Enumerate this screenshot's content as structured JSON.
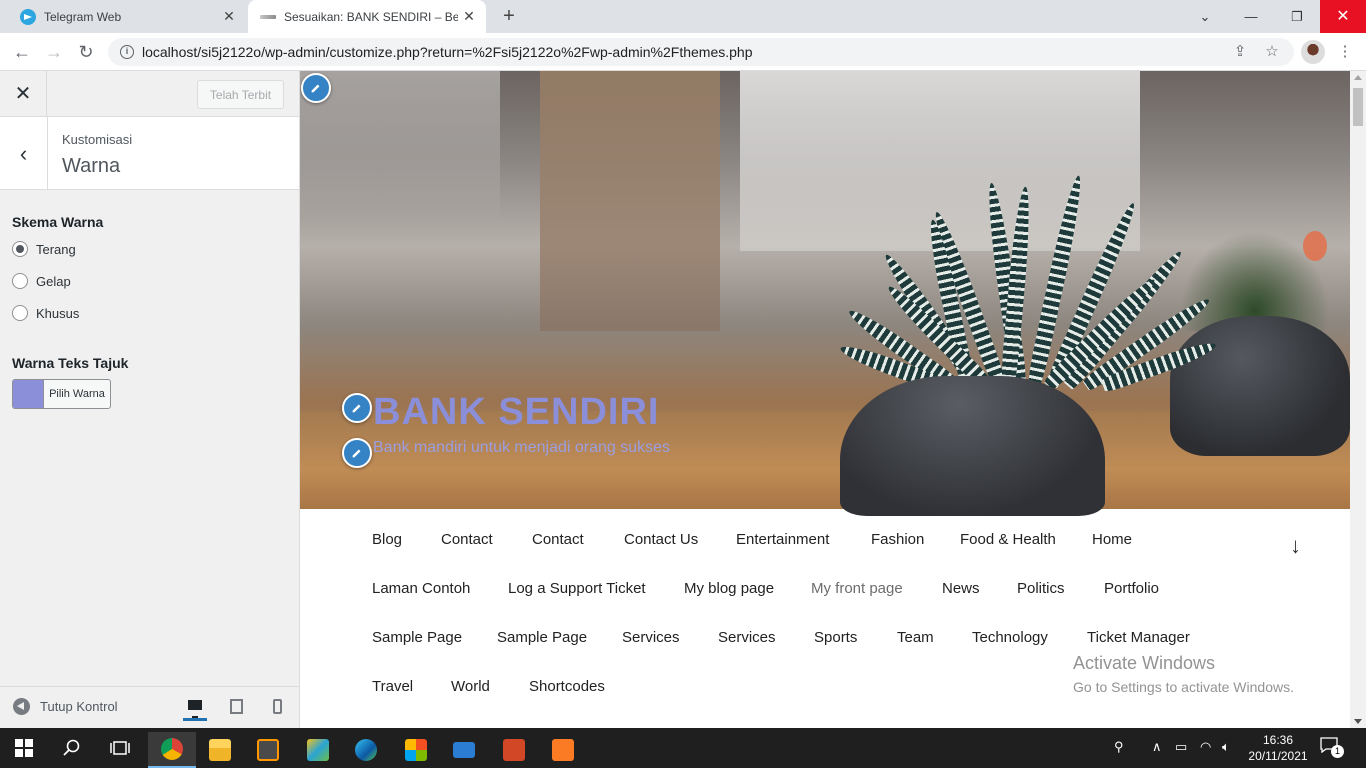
{
  "browser": {
    "tabs": [
      {
        "title": "Telegram Web"
      },
      {
        "title": "Sesuaikan: BANK SENDIRI – Belaj"
      }
    ],
    "url": "localhost/si5j2122o/wp-admin/customize.php?return=%2Fsi5j2122o%2Fwp-admin%2Fthemes.php"
  },
  "sidebar": {
    "publish_label": "Telah Terbit",
    "breadcrumb": "Kustomisasi",
    "section_title": "Warna",
    "color_scheme": {
      "label": "Skema Warna",
      "options": [
        "Terang",
        "Gelap",
        "Khusus"
      ],
      "selected": "Terang"
    },
    "header_text_color": {
      "label": "Warna Teks Tajuk",
      "button_label": "Pilih Warna",
      "value": "#8b8fd9"
    },
    "collapse_label": "Tutup Kontrol"
  },
  "preview": {
    "site_title": "BANK SENDIRI",
    "site_description": "Bank mandiri untuk menjadi orang sukses",
    "menu": [
      [
        "Blog",
        "Contact",
        "Contact",
        "Contact Us",
        "Entertainment",
        "Fashion",
        "Food & Health",
        "Home"
      ],
      [
        "Laman Contoh",
        "Log a Support Ticket",
        "My blog page",
        "My front page",
        "News",
        "Politics",
        "Portfolio"
      ],
      [
        "Sample Page",
        "Sample Page",
        "Services",
        "Services",
        "Sports",
        "Team",
        "Technology",
        "Ticket Manager"
      ],
      [
        "Travel",
        "World",
        "Shortcodes"
      ]
    ],
    "current_menu_item": "My front page",
    "watermark": {
      "line1": "Activate Windows",
      "line2": "Go to Settings to activate Windows."
    }
  },
  "taskbar": {
    "time": "16:36",
    "date": "20/11/2021",
    "notification_count": "1"
  }
}
